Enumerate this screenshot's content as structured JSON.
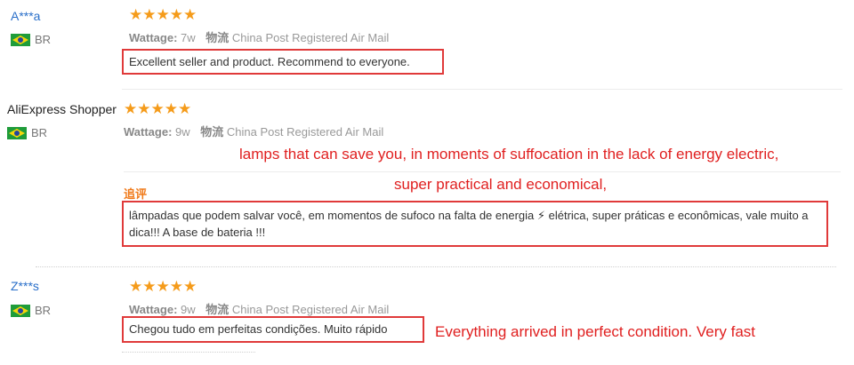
{
  "reviews": [
    {
      "user": "A***a",
      "country": "BR",
      "stars": "★★★★★",
      "wattage_label": "Wattage:",
      "wattage_value": "7w",
      "shipping_label": "物流",
      "shipping_value": "China Post Registered Air Mail",
      "text": "Excellent seller and product. Recommend to everyone."
    },
    {
      "user": "AliExpress Shopper",
      "country": "BR",
      "stars": "★★★★★",
      "wattage_label": "Wattage:",
      "wattage_value": "9w",
      "shipping_label": "物流",
      "shipping_value": "China Post Registered Air Mail",
      "annotation_line1": "lamps that can save you, in moments of suffocation in the lack of energy electric,",
      "annotation_line2": "super practical and economical,",
      "followup_label": "追评",
      "text": "lâmpadas que podem salvar você, em momentos de sufoco na falta de energia ⚡ elétrica, super práticas e econômicas, vale muito a dica!!! A base de bateria !!!"
    },
    {
      "user": "Z***s",
      "country": "BR",
      "stars": "★★★★★",
      "wattage_label": "Wattage:",
      "wattage_value": "9w",
      "shipping_label": "物流",
      "shipping_value": "China Post Registered Air Mail",
      "text": "Chegou tudo em perfeitas condições. Muito rápido",
      "annotation": "Everything arrived in perfect condition. Very fast"
    }
  ],
  "colors": {
    "star": "#f59b1a",
    "highlight_border": "#e03a3a",
    "annotation_text": "#e02020",
    "username_link": "#2a6fc9"
  }
}
